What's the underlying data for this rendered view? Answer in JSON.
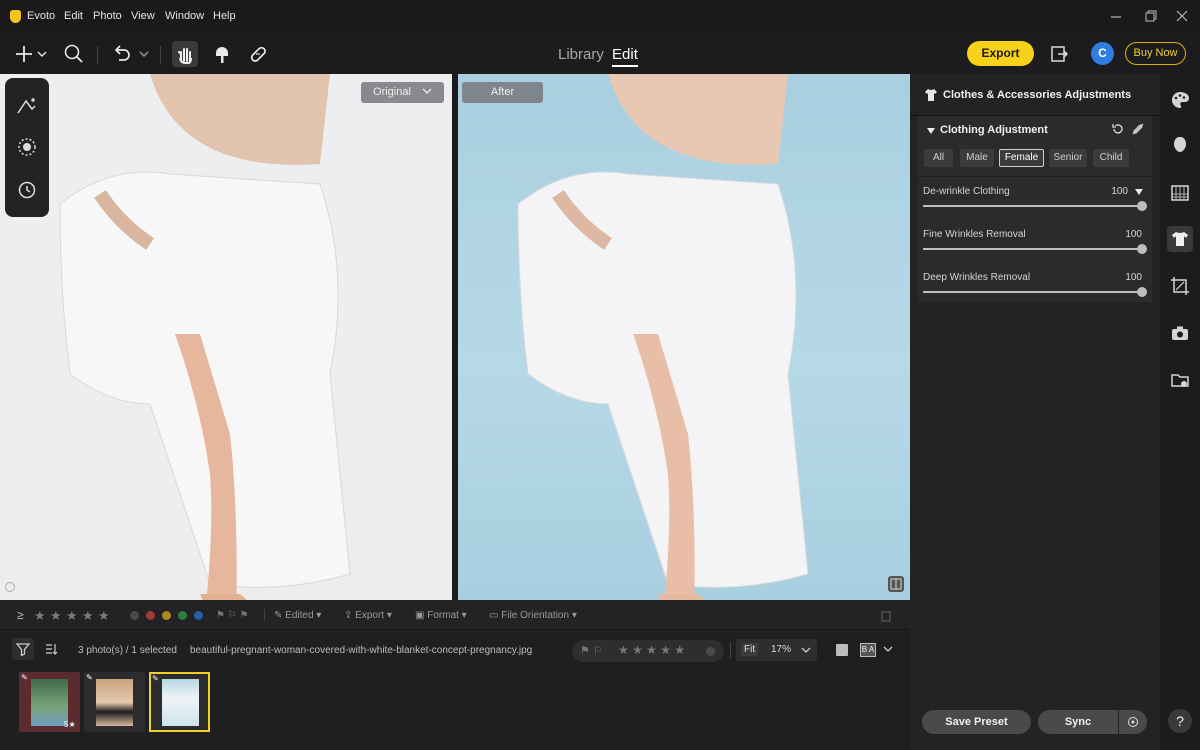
{
  "app": {
    "title": "Evoto",
    "menu": [
      "Edit",
      "Photo",
      "View",
      "Window",
      "Help"
    ]
  },
  "toolbar": {
    "tab_library": "Library",
    "tab_edit": "Edit",
    "export_label": "Export",
    "avatar_letter": "C",
    "buy_now": "Buy Now"
  },
  "canvas": {
    "original_label": "Original",
    "after_label": "After"
  },
  "panel": {
    "section_title": "Clothes & Accessories Adjustments",
    "group_title": "Clothing Adjustment",
    "segments": [
      "All",
      "Male",
      "Female",
      "Senior",
      "Child"
    ],
    "selected_segment": "Female",
    "sliders": [
      {
        "label": "De-wrinkle Clothing",
        "value": "100"
      },
      {
        "label": "Fine Wrinkles Removal",
        "value": "100"
      },
      {
        "label": "Deep Wrinkles Removal",
        "value": "100"
      }
    ],
    "save_preset": "Save Preset",
    "sync": "Sync"
  },
  "filmstrip": {
    "edited": "Edited",
    "export": "Export",
    "format": "Format",
    "file_orientation": "File Orientation",
    "count_text": "3 photo(s) / 1 selected",
    "filename": "beautiful-pregnant-woman-covered-with-white-blanket-concept-pregnancy.jpg",
    "fit": "Fit",
    "zoom": "17%",
    "thumb1_rating": "5"
  },
  "colors": {
    "accent": "#f7d11a",
    "label_colors": [
      "#c0392b",
      "#d4a017",
      "#2e9d3a",
      "#2a6fd1"
    ]
  }
}
